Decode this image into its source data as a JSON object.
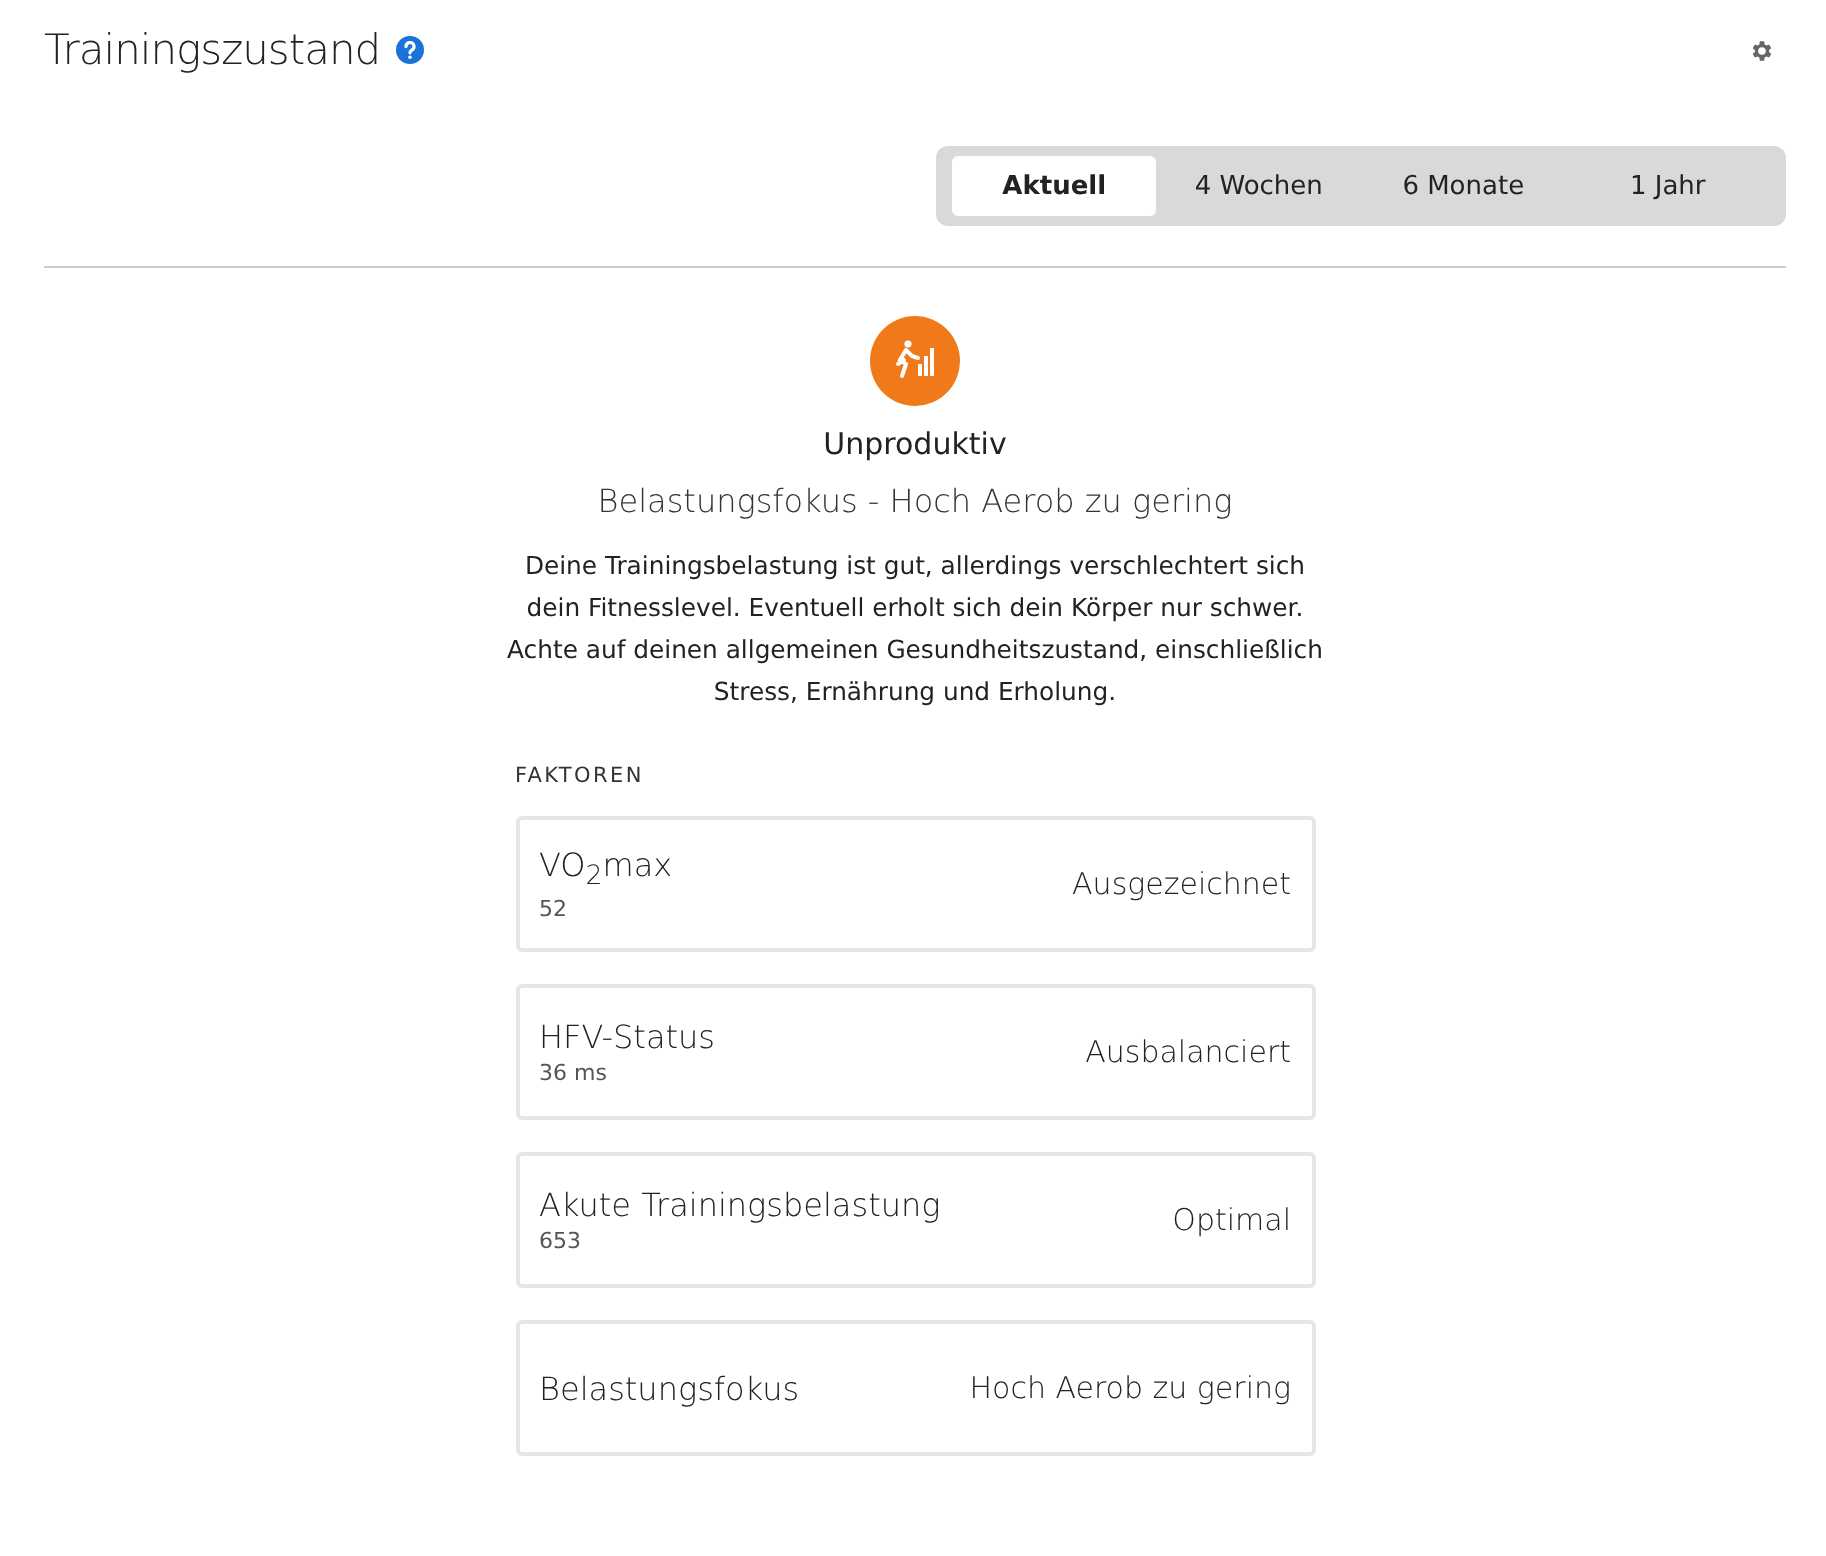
{
  "header": {
    "title": "Trainingszustand"
  },
  "tabs": [
    {
      "label": "Aktuell",
      "selected": true
    },
    {
      "label": "4 Wochen",
      "selected": false
    },
    {
      "label": "6 Monate",
      "selected": false
    },
    {
      "label": "1 Jahr",
      "selected": false
    }
  ],
  "status": {
    "label": "Unproduktiv",
    "focus": "Belastungsfokus - Hoch Aerob zu gering",
    "description": "Deine Trainingsbelastung ist gut, allerdings verschlechtert sich dein Fitnesslevel. Eventuell erholt sich dein Körper nur schwer. Achte auf deinen allgemeinen Gesundheitszustand, einschließlich Stress, Ernährung und Erholung."
  },
  "factors": {
    "heading": "FAKTOREN",
    "items": [
      {
        "name": "VO$_{2}$max",
        "value": "52",
        "rating": "Ausgezeichnet"
      },
      {
        "name": "HFV-Status",
        "value": "36 ms",
        "rating": "Ausbalanciert"
      },
      {
        "name": "Akute Trainingsbelastung",
        "value": "653",
        "rating": "Optimal"
      },
      {
        "name": "Belastungsfokus",
        "rating": "Hoch Aerob zu gering"
      }
    ]
  }
}
